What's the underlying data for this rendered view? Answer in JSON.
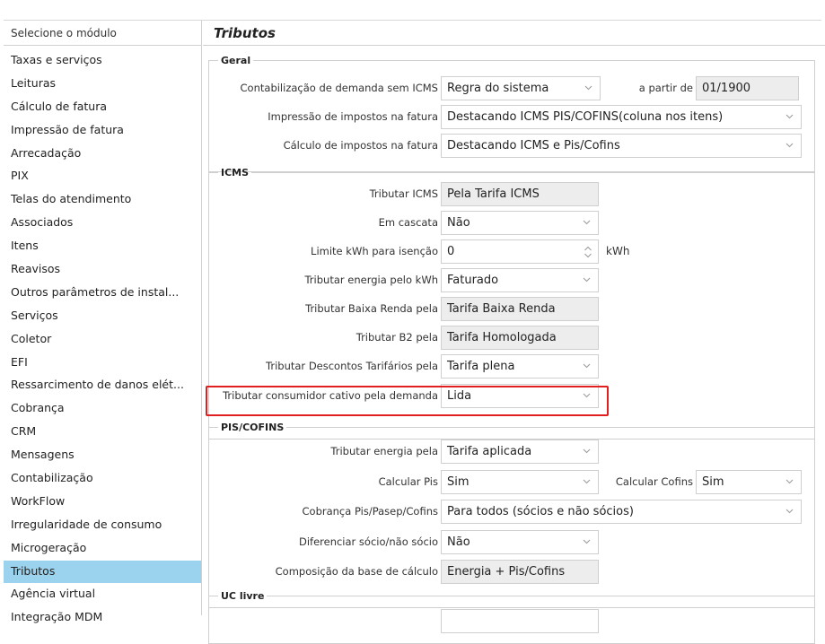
{
  "sidebar": {
    "header": "Selecione o módulo",
    "items": [
      "Taxas e serviços",
      "Leituras",
      "Cálculo de fatura",
      "Impressão de fatura",
      "Arrecadação",
      "PIX",
      "Telas do atendimento",
      "Associados",
      "Itens",
      "Reavisos",
      "Outros parâmetros de instal...",
      "Serviços",
      "Coletor",
      "EFI",
      "Ressarcimento de danos elét...",
      "Cobrança",
      "CRM",
      "Mensagens",
      "Contabilização",
      "WorkFlow",
      "Irregularidade de consumo",
      "Microgeração",
      "Tributos",
      "Agência virtual",
      "Integração MDM"
    ],
    "active_index": 22
  },
  "main": {
    "title": "Tributos",
    "geral": {
      "legend": "Geral",
      "contab_label": "Contabilização de demanda sem ICMS",
      "contab_value": "Regra do sistema",
      "apartir_label": "a partir de",
      "apartir_value": "01/1900",
      "impressao_label": "Impressão de impostos na fatura",
      "impressao_value": "Destacando ICMS PIS/COFINS(coluna nos itens)",
      "calculo_label": "Cálculo de impostos na fatura",
      "calculo_value": "Destacando ICMS e Pis/Cofins"
    },
    "icms": {
      "legend": "ICMS",
      "tributar_label": "Tributar ICMS",
      "tributar_value": "Pela Tarifa ICMS",
      "cascata_label": "Em cascata",
      "cascata_value": "Não",
      "limite_label": "Limite kWh para isenção",
      "limite_value": "0",
      "limite_unit": "kWh",
      "energia_label": "Tributar energia pelo kWh",
      "energia_value": "Faturado",
      "baixa_label": "Tributar Baixa Renda pela",
      "baixa_value": "Tarifa Baixa Renda",
      "b2_label": "Tributar B2 pela",
      "b2_value": "Tarifa Homologada",
      "descontos_label": "Tributar Descontos Tarifários pela",
      "descontos_value": "Tarifa plena",
      "cativo_label": "Tributar consumidor cativo pela demanda",
      "cativo_value": "Lida"
    },
    "pis": {
      "legend": "PIS/COFINS",
      "energia_label": "Tributar energia pela",
      "energia_value": "Tarifa aplicada",
      "calcpis_label": "Calcular Pis",
      "calcpis_value": "Sim",
      "calccofins_label": "Calcular Cofins",
      "calccofins_value": "Sim",
      "cobranca_label": "Cobrança Pis/Pasep/Cofins",
      "cobranca_value": "Para todos (sócios e não sócios)",
      "diferenciar_label": "Diferenciar sócio/não sócio",
      "diferenciar_value": "Não",
      "composicao_label": "Composição da base de cálculo",
      "composicao_value": "Energia + Pis/Cofins"
    },
    "uc": {
      "legend": "UC livre"
    }
  },
  "colors": {
    "active_item": "#9bd3ef",
    "highlight_border": "#e02020",
    "readonly_field": "#ededed"
  }
}
